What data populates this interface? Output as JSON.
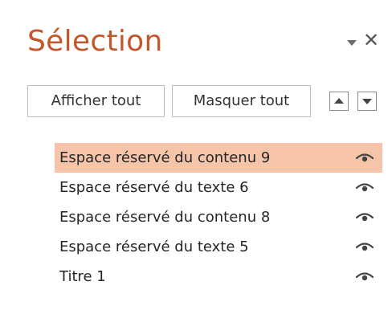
{
  "pane": {
    "title": "Sélection",
    "options_icon": "chevron-down-icon",
    "close_icon": "close-icon",
    "close_glyph": "✕"
  },
  "buttons": {
    "show_all": "Afficher tout",
    "hide_all": "Masquer tout",
    "move_up_icon": "triangle-up-icon",
    "move_down_icon": "triangle-down-icon"
  },
  "items": [
    {
      "label": "Espace réservé du contenu 9",
      "selected": true,
      "visible": true
    },
    {
      "label": "Espace réservé du texte 6",
      "selected": false,
      "visible": true
    },
    {
      "label": "Espace réservé du contenu 8",
      "selected": false,
      "visible": true
    },
    {
      "label": "Espace réservé du texte 5",
      "selected": false,
      "visible": true
    },
    {
      "label": "Titre 1",
      "selected": false,
      "visible": true
    }
  ],
  "colors": {
    "title": "#c5572c",
    "selection_highlight": "#f5c4a9",
    "icon": "#444444"
  }
}
